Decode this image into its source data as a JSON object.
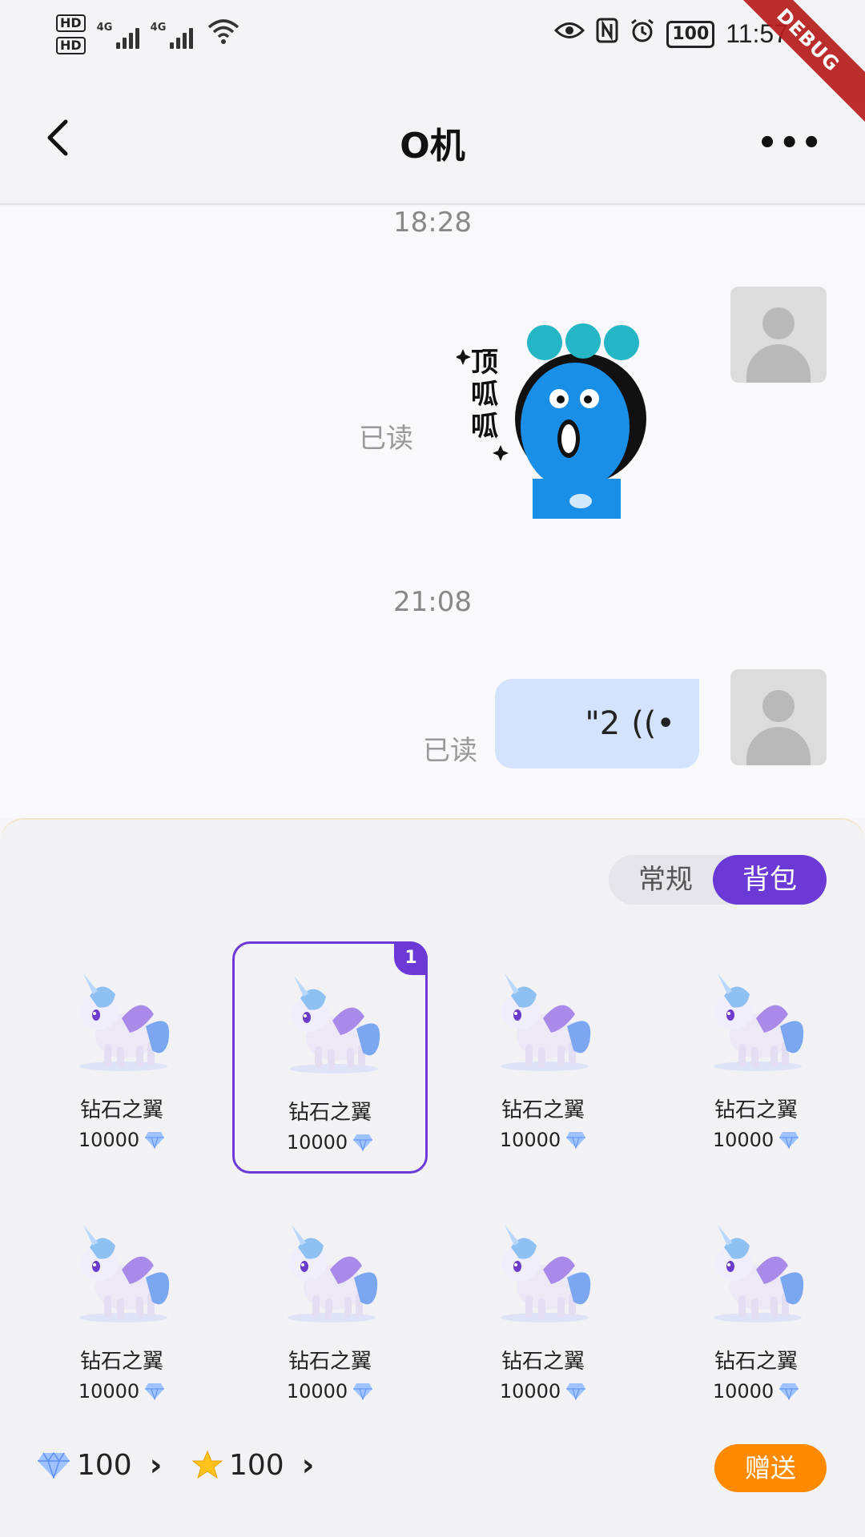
{
  "status": {
    "hd1": "HD",
    "hd2": "HD",
    "net1": "4G",
    "net2": "4G",
    "battery": "100",
    "time": "11:57"
  },
  "debug": "DEBUG",
  "nav": {
    "title": "O机",
    "more": "•••"
  },
  "chat": {
    "ts1": "18:28",
    "ts2": "21:08",
    "read1": "已读",
    "read2": "已读",
    "sticker_text": [
      "顶",
      "呱",
      "呱"
    ],
    "voice_duration": "\"2",
    "voice_icon": "((•"
  },
  "panel": {
    "tab_normal": "常规",
    "tab_bag": "背包",
    "gifts": [
      {
        "name": "钻石之翼",
        "price": "10000"
      },
      {
        "name": "钻石之翼",
        "price": "10000",
        "count": "1"
      },
      {
        "name": "钻石之翼",
        "price": "10000"
      },
      {
        "name": "钻石之翼",
        "price": "10000"
      },
      {
        "name": "钻石之翼",
        "price": "10000"
      },
      {
        "name": "钻石之翼",
        "price": "10000"
      },
      {
        "name": "钻石之翼",
        "price": "10000"
      },
      {
        "name": "钻石之翼",
        "price": "10000"
      }
    ],
    "diamond_balance": "100",
    "star_balance": "100",
    "send_label": "赠送"
  },
  "colors": {
    "accent": "#6b3ad6",
    "send": "#ff8a00",
    "bubble": "#d4e3fd"
  }
}
